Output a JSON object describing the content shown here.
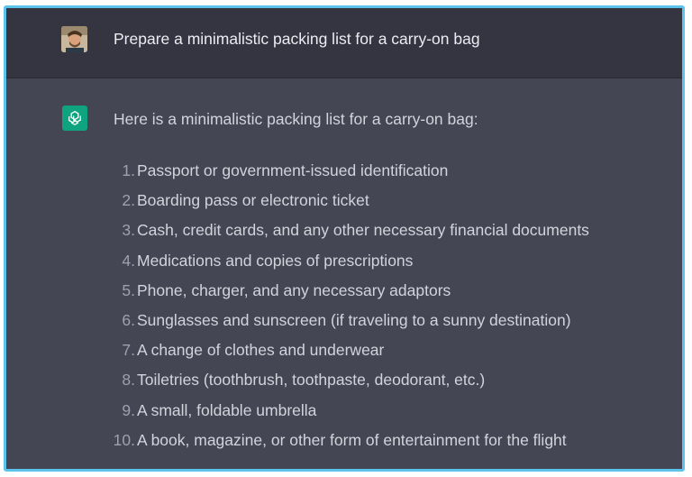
{
  "user_message": {
    "text": "Prepare a minimalistic packing list for a carry-on bag",
    "avatar_icon": "user-avatar-photo"
  },
  "assistant_message": {
    "avatar_icon": "chatgpt-logo-icon",
    "intro": "Here is a minimalistic packing list for a carry-on bag:",
    "items": [
      {
        "number": "1.",
        "text": "Passport or government-issued identification"
      },
      {
        "number": "2.",
        "text": "Boarding pass or electronic ticket"
      },
      {
        "number": "3.",
        "text": "Cash, credit cards, and any other necessary financial documents"
      },
      {
        "number": "4.",
        "text": "Medications and copies of prescriptions"
      },
      {
        "number": "5.",
        "text": "Phone, charger, and any necessary adaptors"
      },
      {
        "number": "6.",
        "text": "Sunglasses and sunscreen (if traveling to a sunny destination)"
      },
      {
        "number": "7.",
        "text": "A change of clothes and underwear"
      },
      {
        "number": "8.",
        "text": "Toiletries (toothbrush, toothpaste, deodorant, etc.)"
      },
      {
        "number": "9.",
        "text": "A small, foldable umbrella"
      },
      {
        "number": "10.",
        "text": "A book, magazine, or other form of entertainment for the flight"
      }
    ]
  },
  "colors": {
    "user_row_bg": "#343541",
    "assistant_row_bg": "#444654",
    "frame_border": "#5cc4ea",
    "brand_green": "#10a37f"
  }
}
